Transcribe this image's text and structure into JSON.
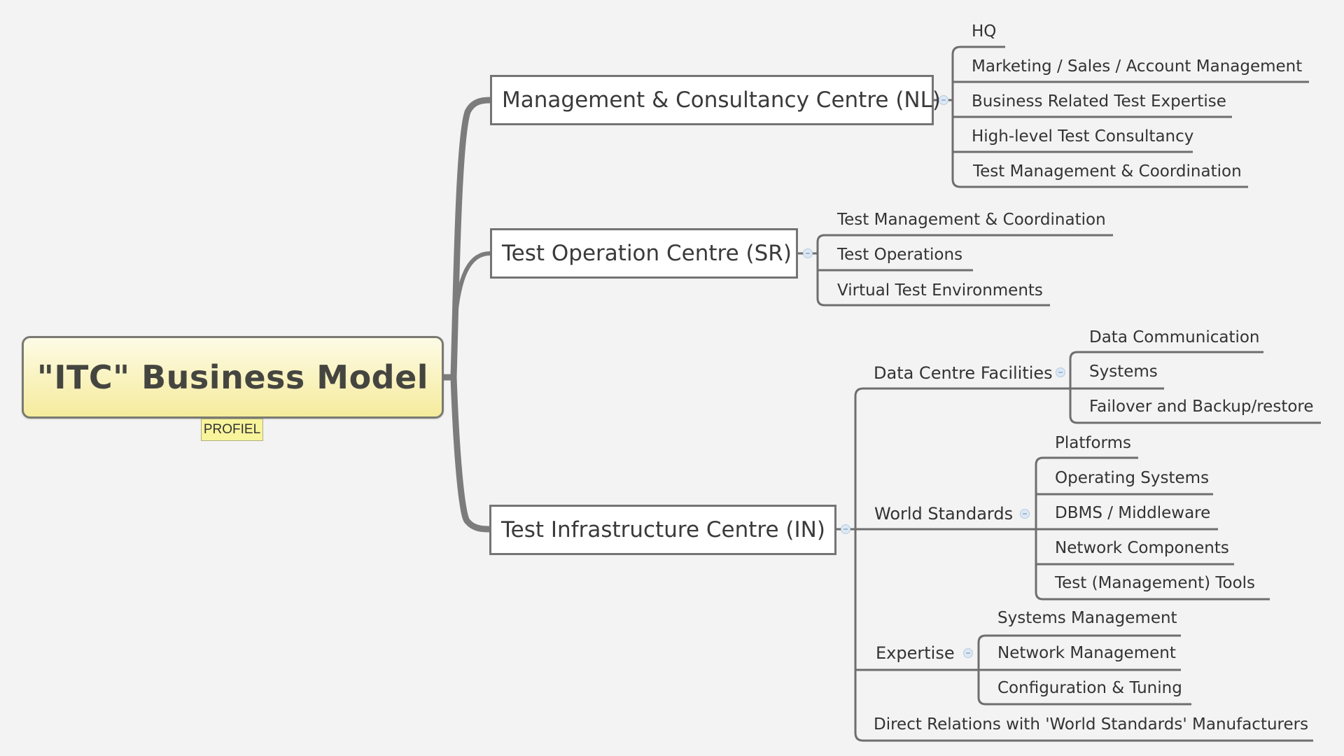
{
  "root": {
    "title": "\"ITC\" Business Model",
    "tag": "PROFIEL"
  },
  "branches": [
    {
      "label": "Management & Consultancy Centre (NL)",
      "children": [
        "HQ",
        "Marketing / Sales / Account Management",
        "Business Related Test Expertise",
        "High-level Test Consultancy",
        "Test Management & Coordination"
      ]
    },
    {
      "label": "Test Operation Centre (SR)",
      "children": [
        "Test Management & Coordination",
        "Test Operations",
        "Virtual Test Environments"
      ]
    },
    {
      "label": "Test Infrastructure Centre (IN)",
      "groups": [
        {
          "label": "Data Centre Facilities",
          "children": [
            "Data Communication",
            "Systems",
            "Failover and Backup/restore"
          ]
        },
        {
          "label": "World Standards",
          "children": [
            "Platforms",
            "Operating Systems",
            "DBMS / Middleware",
            "Network Components",
            "Test (Management) Tools"
          ]
        },
        {
          "label": "Expertise",
          "children": [
            "Systems Management",
            "Network Management",
            "Configuration & Tuning"
          ]
        },
        {
          "label": "Direct Relations with 'World Standards' Manufacturers"
        }
      ]
    }
  ],
  "icons": {
    "collapse": "collapse-minus-icon"
  }
}
